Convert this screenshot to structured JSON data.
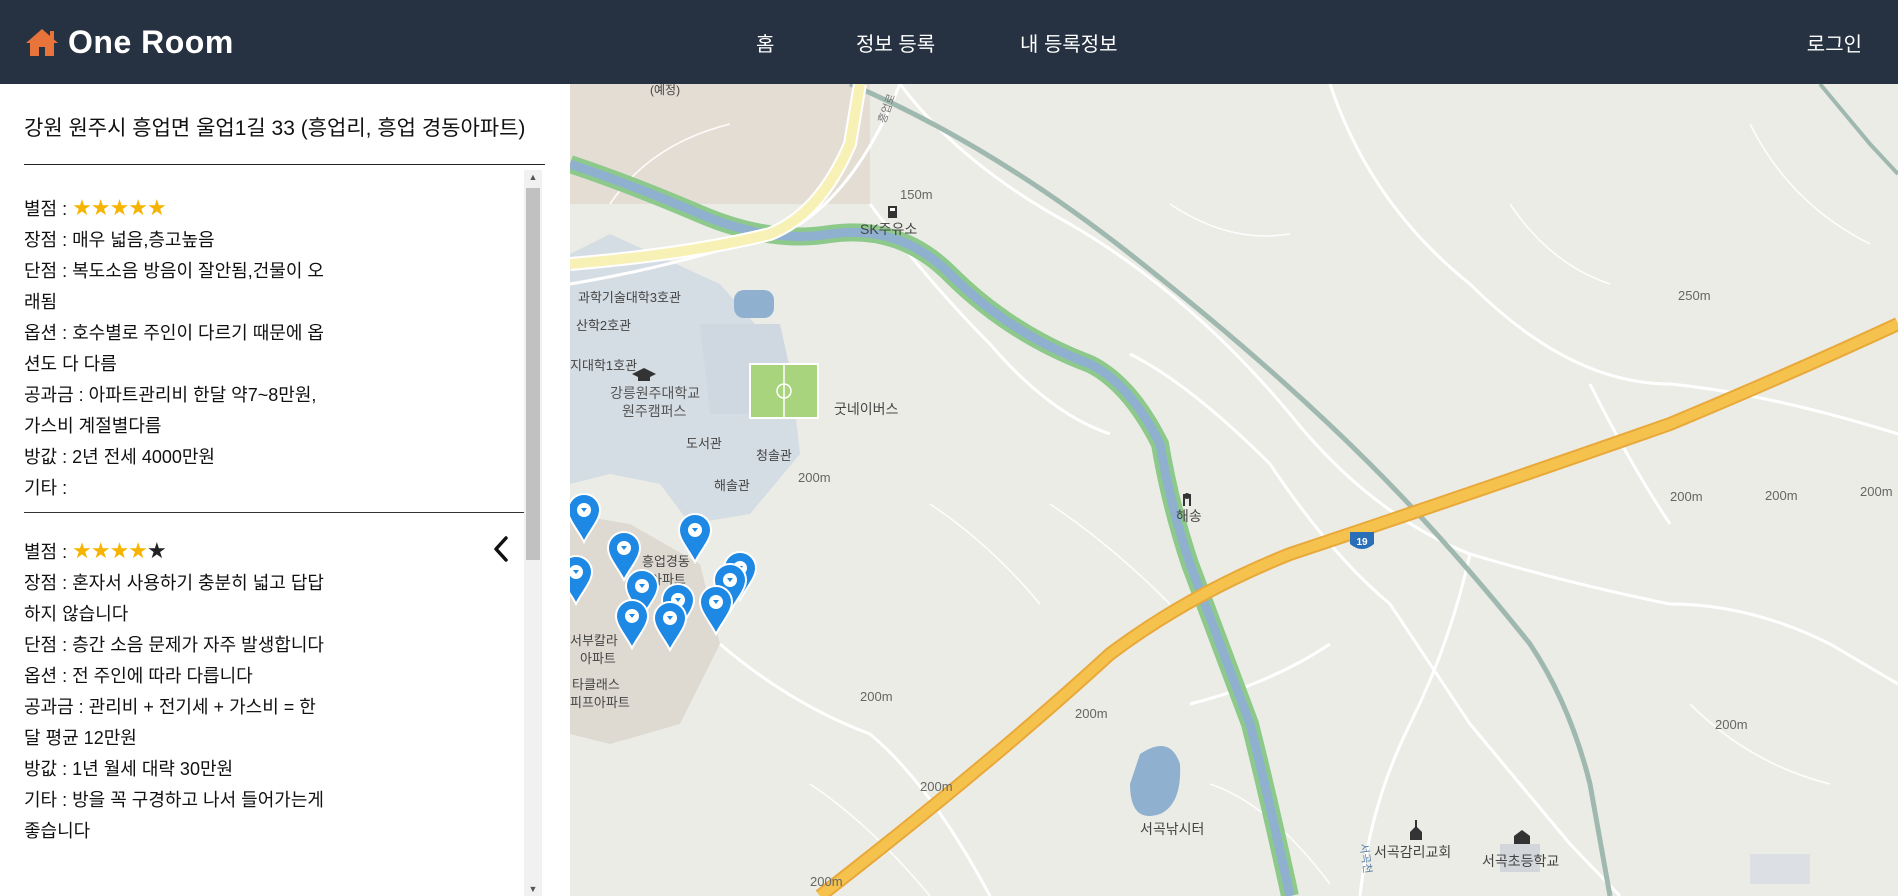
{
  "nav": {
    "brand": "One Room",
    "menu": [
      "홈",
      "정보 등록",
      "내 등록정보"
    ],
    "login": "로그인"
  },
  "panel": {
    "address": "강원 원주시 흥업면 울업1길 33 (흥업리, 흥업 경동아파트)",
    "reviews": [
      {
        "rating_label": "별점 :",
        "rating": 5,
        "lines": [
          "장점 : 매우 넓음,층고높음",
          "단점 : 복도소음 방음이 잘안됨,건물이 오래됨",
          "옵션 : 호수별로 주인이 다르기 때문에 옵션도 다 다름",
          "공과금 : 아파트관리비 한달 약7~8만원, 가스비 계절별다름",
          "방값 : 2년 전세 4000만원",
          "기타 :"
        ]
      },
      {
        "rating_label": "별점 :",
        "rating": 4,
        "lines": [
          "장점 : 혼자서 사용하기 충분히 넓고 답답하지 않습니다",
          "단점 : 층간 소음 문제가 자주 발생합니다",
          "옵션 : 전 주인에 따라 다릅니다",
          "공과금 : 관리비 + 전기세 + 가스비 = 한달 평균 12만원",
          "방값 : 1년 월세 대략 30만원",
          "기타 : 방을 꼭 구경하고 나서 들어가는게 좋습니다"
        ]
      }
    ]
  },
  "map": {
    "labels": {
      "sk": "SK주유소",
      "tech3": "과학기술대학3호관",
      "sanhak2": "산학2호관",
      "univ1": "지대학1호관",
      "campus1": "강릉원주대학교",
      "campus2": "원주캠퍼스",
      "library": "도서관",
      "cheongsong": "청솔관",
      "haesol": "해솔관",
      "goodbus": "굿네이버스",
      "haesong": "해송",
      "heungeop1": "흥업경동",
      "heungeop2": "아파트",
      "seobu1": "서부칼라",
      "seobu2": "아파트",
      "taklass1": "타클래스",
      "taklass2": "피프아파트",
      "fishing": "서곡낚시터",
      "church": "서곡감리교회",
      "school": "서곡초등학교",
      "seogokcheon": "서곡천",
      "route": "19",
      "top_partial": "(예정)",
      "road_label": "흥업로"
    },
    "contours": [
      "150m",
      "250m",
      "200m",
      "200m",
      "200m",
      "200m",
      "200m",
      "200m",
      "200m",
      "200m",
      "200m"
    ],
    "marker_color": "#1e88e5",
    "marker_count": 11
  },
  "colors": {
    "nav_bg": "#263142",
    "star": "#f6b400",
    "brand_icon": "#e8743b",
    "highway": "#f4b63f",
    "river": "#8fb0cf",
    "river_bank": "#8dc98a"
  }
}
